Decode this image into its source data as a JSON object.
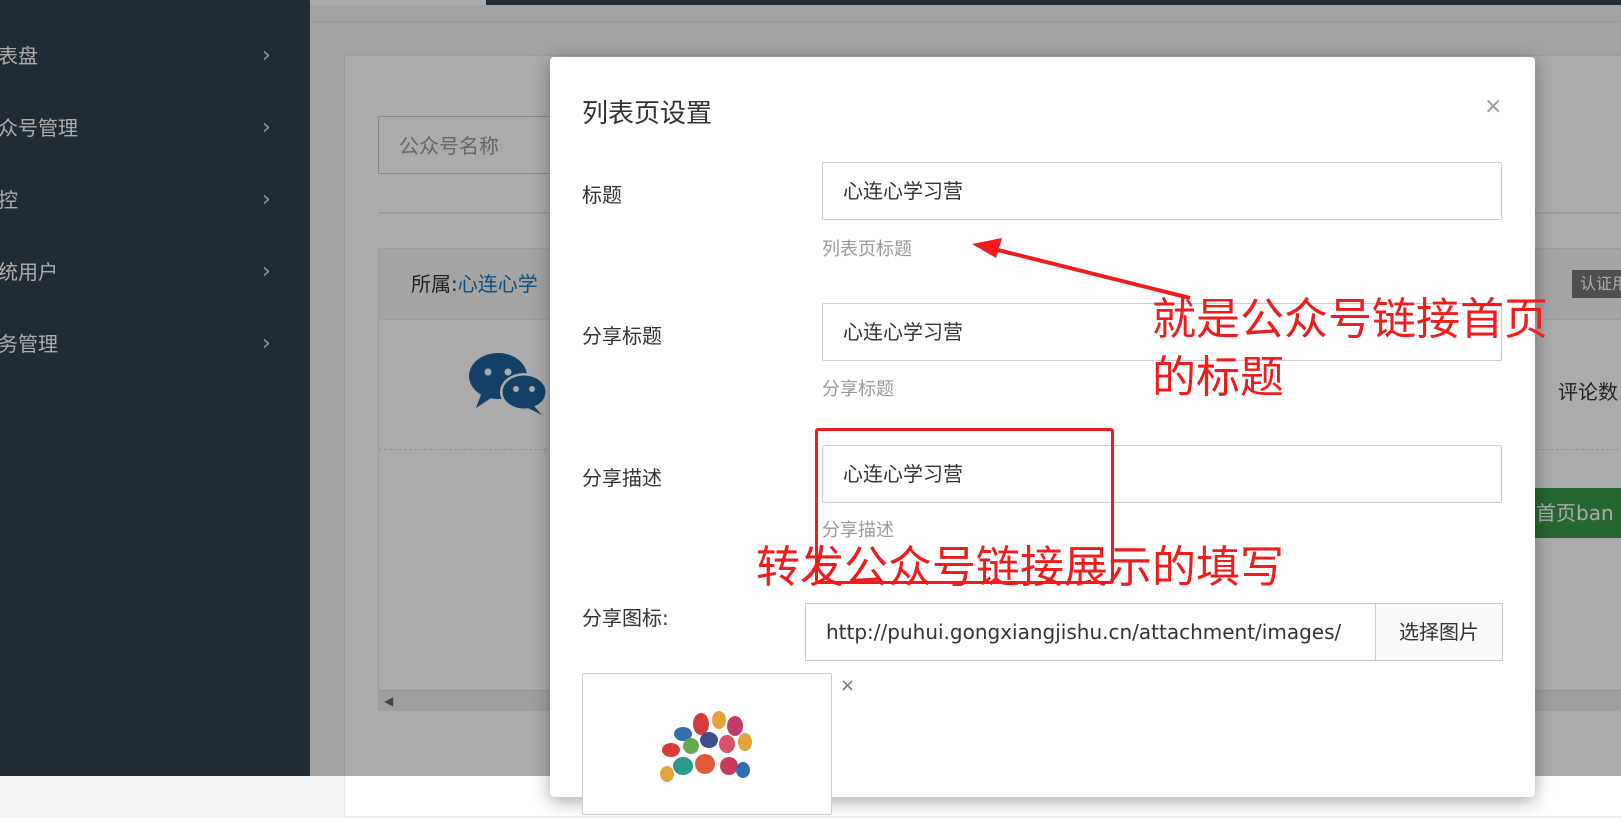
{
  "sidebar": {
    "items": [
      {
        "label": "表盘"
      },
      {
        "label": "众号管理"
      },
      {
        "label": "控"
      },
      {
        "label": "统用户"
      },
      {
        "label": "务管理"
      }
    ],
    "chevron": "›"
  },
  "background": {
    "search_placeholder": "公众号名称",
    "belong_label": "所属:",
    "belong_value": "心连心学",
    "badge_text": "认证用",
    "comment_text": "评论数",
    "green_button_text": "首页ban"
  },
  "modal": {
    "title": "列表页设置",
    "close": "×",
    "fields": [
      {
        "label": "标题",
        "value": "心连心学习营",
        "help": "列表页标题"
      },
      {
        "label": "分享标题",
        "value": "心连心学习营",
        "help": "分享标题"
      },
      {
        "label": "分享描述",
        "value": "心连心学习营",
        "help": "分享描述"
      }
    ],
    "icon_label": "分享图标:",
    "icon_url": "http://puhui.gongxiangjishu.cn/attachment/images/",
    "pick_button": "选择图片",
    "thumb_remove": "×"
  },
  "annotations": {
    "title_note_line1": "就是公众号链接首页",
    "title_note_line2": "的标题",
    "share_note": "转发公众号链接展示的填写",
    "color": "#ee1c1c"
  }
}
